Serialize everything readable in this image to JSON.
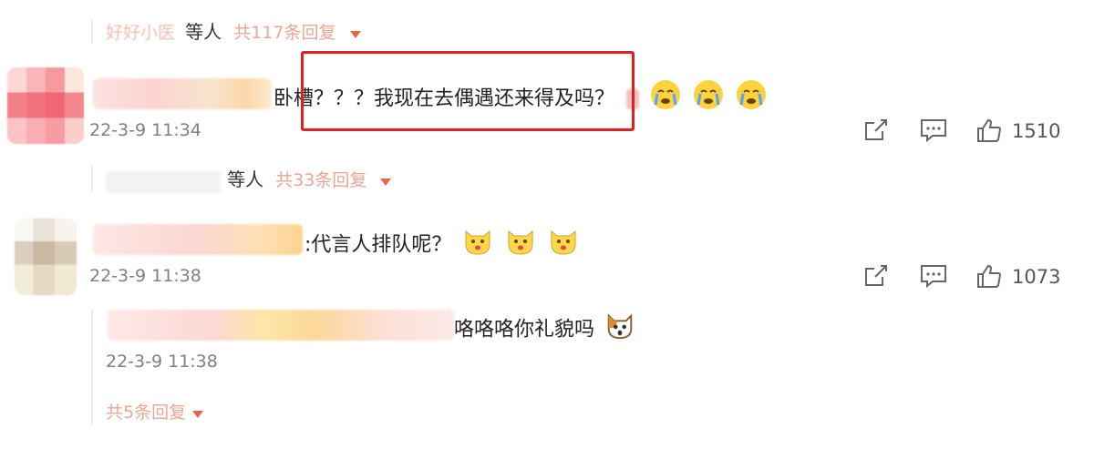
{
  "comment_group_top": {
    "name_blurred_prefix": "好好小医",
    "others_label": "等人",
    "replies_label": "共117条回复"
  },
  "comment1": {
    "text": "卧槽？？？我现在去偶遇还来得及吗？",
    "time": "22-3-9 11:34",
    "likes": "1510",
    "replies_others_label": "等人",
    "replies_label": "共33条回复",
    "emojis": [
      "crying-face",
      "crying-face",
      "crying-face"
    ]
  },
  "comment2": {
    "text": ":代言人排队呢？",
    "time": "22-3-9 11:38",
    "likes": "1073",
    "emojis": [
      "cat-face",
      "cat-face",
      "cat-face"
    ]
  },
  "reply": {
    "text": "咯咯咯你礼貌吗",
    "time": "22-3-9 11:38",
    "more_replies_label": "共5条回复",
    "emoji": "shocked-cat-face"
  },
  "colors": {
    "accent": "#e06a4a",
    "highlight": "#e02020"
  }
}
